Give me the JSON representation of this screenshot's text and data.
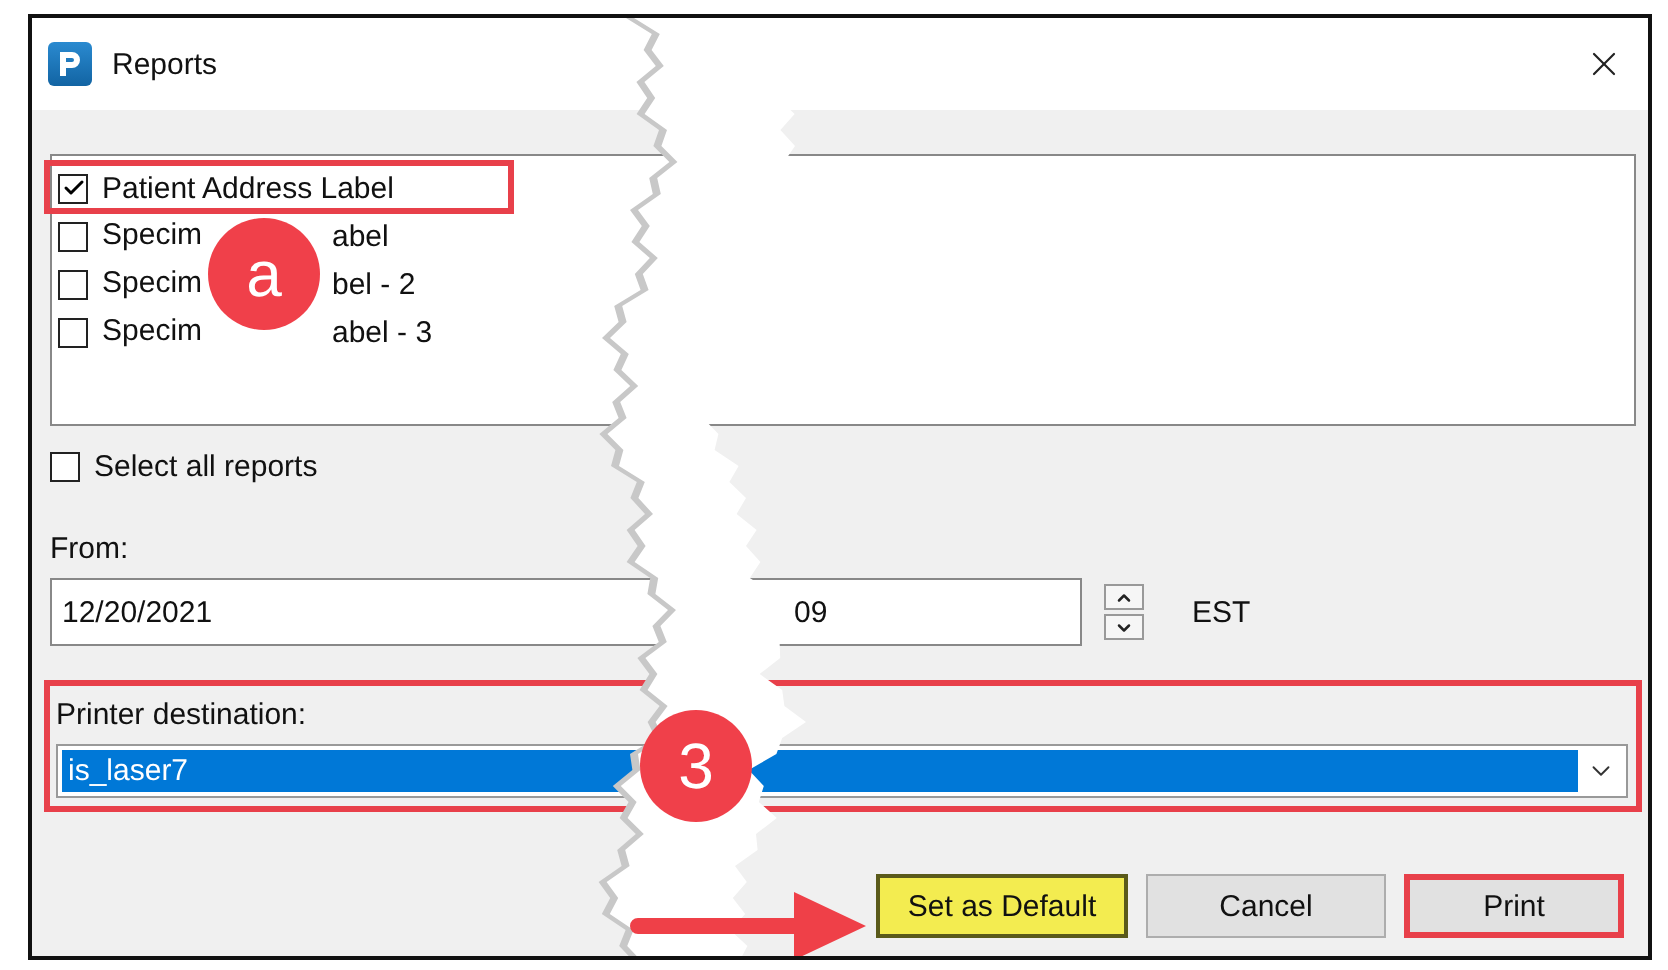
{
  "window": {
    "title": "Reports"
  },
  "reports": [
    {
      "label": "Patient Address Label",
      "checked": true,
      "annotated": true
    },
    {
      "label": "Specim",
      "label_after_badge": "abel",
      "checked": false,
      "annotated": false
    },
    {
      "label": "Specim",
      "label_after_badge": "bel - 2",
      "checked": false,
      "annotated": false
    },
    {
      "label": "Specim",
      "label_after_badge": "abel - 3",
      "checked": false,
      "annotated": false
    }
  ],
  "select_all": {
    "label": "Select all reports",
    "checked": false
  },
  "from": {
    "label": "From:",
    "date": "12/20/2021",
    "time": "09",
    "zone": "EST"
  },
  "printer": {
    "label": "Printer destination:",
    "value": "is_laser7",
    "annotated": true
  },
  "buttons": [
    {
      "label": "Set as Default",
      "highlighted": true,
      "annotated": false
    },
    {
      "label": "Cancel",
      "highlighted": false,
      "annotated": false
    },
    {
      "label": "Print",
      "highlighted": false,
      "annotated": true
    }
  ],
  "step_badges": [
    "a",
    "3"
  ]
}
